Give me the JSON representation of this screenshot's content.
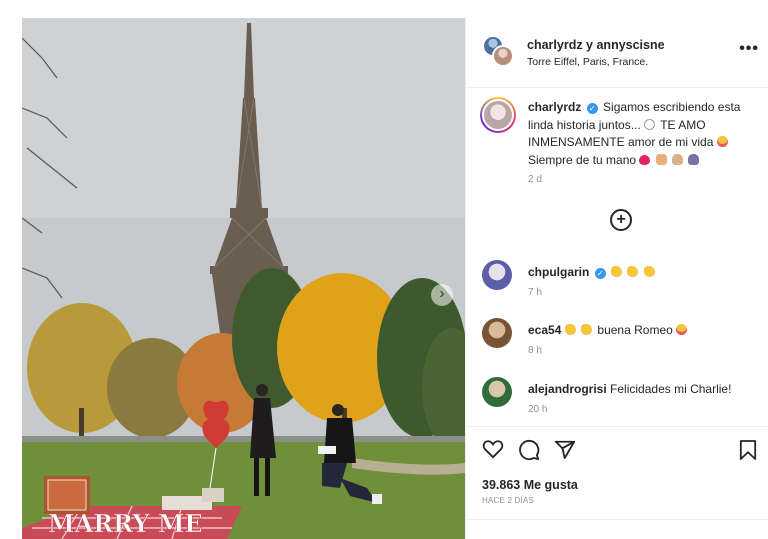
{
  "header": {
    "users": "charlyrdz y annyscisne",
    "location": "Torre Eiffel, Paris, France.",
    "more_icon": "more-horizontal-icon",
    "more_glyph": "•••"
  },
  "photo": {
    "sign_text": "MARRY ME",
    "next_glyph": "›"
  },
  "caption": {
    "username": "charlyrdz",
    "verified_glyph": "✓",
    "line1": "Sigamos escribiendo esta linda historia juntos...",
    "line2": "TE AMO INMENSAMENTE amor de mi vida",
    "line3": "Siempre de tu mano",
    "time": "2 d"
  },
  "add_comment_glyph": "+",
  "comments": [
    {
      "username": "chpulgarin",
      "text": "",
      "time": "7 h"
    },
    {
      "username": "eca54",
      "text": "buena Romeo",
      "time": "8 h"
    },
    {
      "username": "alejandrogrisi",
      "text": "Felicidades mi Charlie!",
      "time": "20 h"
    }
  ],
  "actions": {
    "like_icon": "heart-icon",
    "comment_icon": "comment-icon",
    "share_icon": "send-icon",
    "save_icon": "bookmark-icon"
  },
  "likes_text": "39.863 Me gusta",
  "date_text": "HACE 2 DÍAS",
  "colors": {
    "verified": "#3897f0",
    "muted": "#8e8e8e",
    "text": "#262626",
    "divider": "#efefef"
  }
}
